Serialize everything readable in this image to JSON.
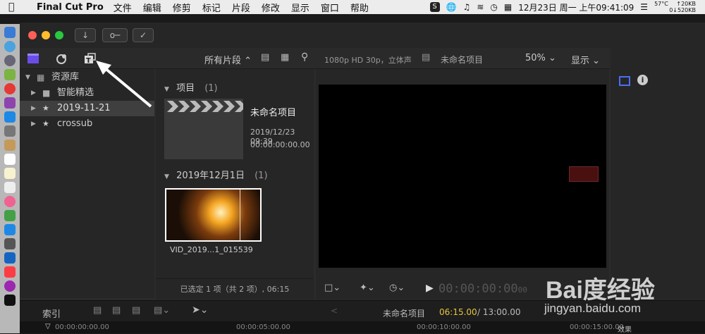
{
  "menubar": {
    "app_name": "Final Cut Pro",
    "items": [
      "文件",
      "编辑",
      "修剪",
      "标记",
      "片段",
      "修改",
      "显示",
      "窗口",
      "帮助"
    ],
    "status": {
      "s_icon": "S",
      "datetime": "12月23日 周一 上午09:41:09",
      "temp": "57°C",
      "upload": "↑20KB",
      "download": "0↓520KB"
    }
  },
  "toolbar": {
    "filter_label": "所有片段 ⌃",
    "import_icon": "↓",
    "key_icon": "o─",
    "check_icon": "✓"
  },
  "sidebar": {
    "library_label": "资源库",
    "items": [
      {
        "label": "智能精选"
      },
      {
        "label": "2019-11-21"
      },
      {
        "label": "crossub"
      }
    ]
  },
  "browser": {
    "project_section": {
      "title": "项目",
      "count": "(1)"
    },
    "project": {
      "name": "未命名项目",
      "date": "2019/12/23 09:39",
      "timecode": "00:00:00:00.00"
    },
    "event_section": {
      "title": "2019年12月1日",
      "count": "(1)"
    },
    "clip": {
      "name": "VID_2019...1_015539"
    },
    "footer": "已选定 1 项（共 2 项）, 06:15"
  },
  "viewer": {
    "format": "1080p HD 30p，立体声",
    "project_name": "未命名项目",
    "zoom": "50%",
    "display_menu": "显示",
    "timecode": "00:00:00:00",
    "timecode_frames": "00"
  },
  "timeline": {
    "index_label": "索引",
    "project_name": "未命名项目",
    "duration_current": "06:15.00",
    "duration_total": "/ 13:00.00",
    "ruler": [
      "00:00:00:00.00",
      "00:00:05:00.00",
      "00:00:10:00.00",
      "00:00:15:00.00"
    ],
    "effects_label": "效果"
  },
  "watermark": {
    "brand": "Bai度经验",
    "url": "jingyan.baidu.com"
  },
  "colors": {
    "accent_yellow": "#e8c341",
    "traffic_red": "#fc5f57",
    "traffic_yellow": "#fdbc2e",
    "traffic_green": "#28c840",
    "selection": "#3f3f3f"
  }
}
